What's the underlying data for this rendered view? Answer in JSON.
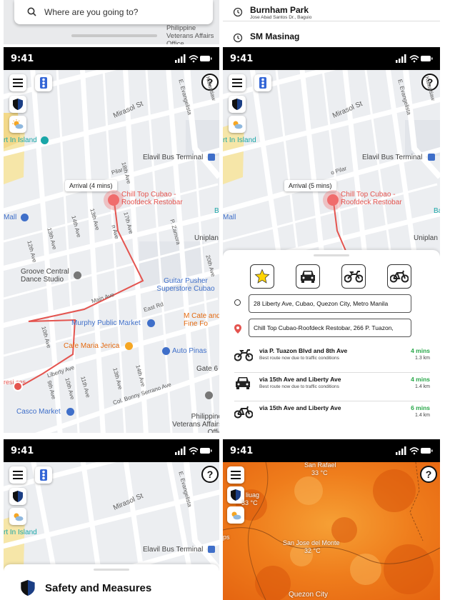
{
  "search": {
    "placeholder": "Where are you going to?"
  },
  "recents": [
    {
      "title": "Burnham Park",
      "subtitle": "Jose Abad Santos Dr., Baguio"
    },
    {
      "title": "SM Masinag",
      "subtitle": ""
    }
  ],
  "top_strip": {
    "partial_label": "Philippine Veterans Affairs Office"
  },
  "status": {
    "time": "9:41"
  },
  "help_label": "?",
  "map_labels": {
    "mirasol": "Mirasol St",
    "evangelista": "E. Evangelista",
    "kalantiaw": "Kalantiaw",
    "in_island": "rt In Island",
    "elavil": "Elavil Bus Terminal",
    "pilar": "Pilar",
    "pilar2": "o Pilar",
    "ave18": "18th Ave",
    "ave17": "17th Ave",
    "ave15": "15th Ave",
    "ave14": "14th Ave",
    "ave13": "13th Ave",
    "ave12": "12th Ave",
    "ave11": "11th Ave",
    "ave10": "10th Ave",
    "ave9": "9th Ave",
    "ave20": "20th Ave",
    "zamora": "P. Zamora",
    "liberty_short": "n Ave",
    "mall": "Mall",
    "uniplan": "Uniplan",
    "ba": "Ba",
    "groove": "Groove Central Dance Studio",
    "guitar": "Guitar Pusher Superstore Cubao",
    "main_ave": "Main Ave",
    "east_rd": "East Rd",
    "murphy": "Murphy Public Market",
    "m_cate": "M Cate and Fine Fo",
    "maria": "Cafe Maria Jerica",
    "auto": "Auto Pinas",
    "gate6": "Gate 6",
    "liberty": "Liberty Ave",
    "serrano": "Col. Bonny Serrano Ave",
    "casco": "Casco Market",
    "veterans": "Philippine Veterans Affairs Offic",
    "origin_short": "resi ces",
    "chill_top": "Chill Top Cubao - Roofdeck Restobar"
  },
  "panel_a": {
    "arrival": "Arrival (4 mins)"
  },
  "panel_b": {
    "arrival": "Arrival (5 mins)",
    "from": "28 Liberty Ave, Cubao, Quezon City, Metro Manila",
    "to": "Chill Top Cubao-Roofdeck Restobar, 266 P. Tuazon,",
    "routes": [
      {
        "mode": "motorcycle",
        "via": "via P. Tuazon Blvd and 8th Ave",
        "note": "Best route now due to traffic conditions",
        "time": "4 mins",
        "dist": "1.3 km"
      },
      {
        "mode": "car",
        "via": "via 15th Ave and Liberty Ave",
        "note": "Best route now due to traffic conditions",
        "time": "4 mins",
        "dist": "1.4 km"
      },
      {
        "mode": "bicycle",
        "via": "via 15th Ave and Liberty Ave",
        "note": "",
        "time": "6 mins",
        "dist": "1.4 km"
      }
    ]
  },
  "panel_c": {
    "sheet_title": "Safety and Measures"
  },
  "panel_d": {
    "san_rafael": "San Rafael",
    "san_rafael_temp": "33 °C",
    "liuag": "liuag",
    "liuag_temp": "33 °C",
    "sjdm": "San Jose del Monte",
    "sjdm_temp": "32 °C",
    "quezon": "Quezon City",
    "ps": "ps"
  },
  "colors": {
    "route": "#e4544f",
    "accent_green": "#2aa84a",
    "poi_blue": "#3f6fc9",
    "star": "#ffd400",
    "heat_orange": "#f07a18"
  }
}
